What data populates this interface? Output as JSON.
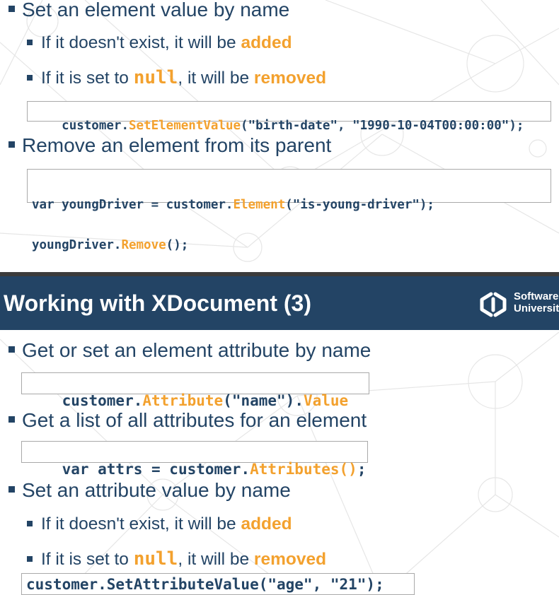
{
  "slide_top": {
    "b1": "Set an element value by name",
    "b1_sub1_pre": "If it doesn't exist, it will be ",
    "b1_sub1_hl": "added",
    "b1_sub2_pre": "If it is set to ",
    "b1_sub2_code": "null",
    "b1_sub2_mid": ", it will be ",
    "b1_sub2_hl": "removed",
    "code1": {
      "obj": "customer.",
      "method": "SetElementValue",
      "args": "(\"birth-date\", \"1990-10-04T00:00:00\");"
    },
    "b2": "Remove an element from its parent",
    "code2": {
      "l1_pre": "var youngDriver = customer.",
      "l1_method": "Element",
      "l1_args": "(\"is-young-driver\");",
      "l2_pre": "youngDriver.",
      "l2_method": "Remove",
      "l2_args": "();"
    }
  },
  "header": {
    "title": "Working with XDocument (3)",
    "logo_line1": "Software",
    "logo_line2": "University"
  },
  "slide_bottom": {
    "b1": "Get or set an element attribute by name",
    "code1": {
      "obj": "customer.",
      "method": "Attribute",
      "args": "(\"name\").",
      "prop": "Value"
    },
    "b2": "Get a list of all attributes for an element",
    "code2": {
      "pre": "var attrs = customer.",
      "method": "Attributes()",
      "end": ";"
    },
    "b3": "Set an attribute value by name",
    "b3_sub1_pre": "If it doesn't exist, it will be ",
    "b3_sub1_hl": "added",
    "b3_sub2_pre": "If it is set to ",
    "b3_sub2_code": "null",
    "b3_sub2_mid": ", it will be ",
    "b3_sub2_hl": "removed",
    "code3": "customer.SetAttributeValue(\"age\", \"21\");"
  },
  "colors": {
    "primary": "#234465",
    "accent": "#f3a12e",
    "background": "#ffffff",
    "network": "#e6e6e6"
  }
}
